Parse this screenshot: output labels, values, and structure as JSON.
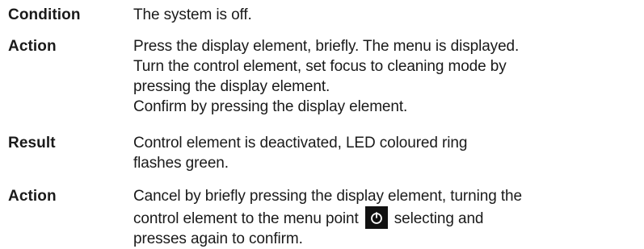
{
  "rows": [
    {
      "label": "Condition",
      "lines": [
        "The system is off."
      ]
    },
    {
      "label": "Action",
      "lines": [
        "Press the display element, briefly. The menu is displayed.",
        "Turn the control element, set focus to cleaning mode by",
        "pressing the display element.",
        "Confirm by pressing the display element."
      ]
    },
    {
      "label": "Result",
      "lines": [
        "Control element is deactivated, LED coloured ring",
        "flashes green."
      ]
    },
    {
      "label": "Action",
      "lines": [
        "Cancel by briefly pressing the display element, turning the",
        "control element to the menu point",
        "selecting and",
        "presses again to confirm."
      ]
    }
  ],
  "icons": {
    "menu_point_icon": "power-off-icon"
  }
}
